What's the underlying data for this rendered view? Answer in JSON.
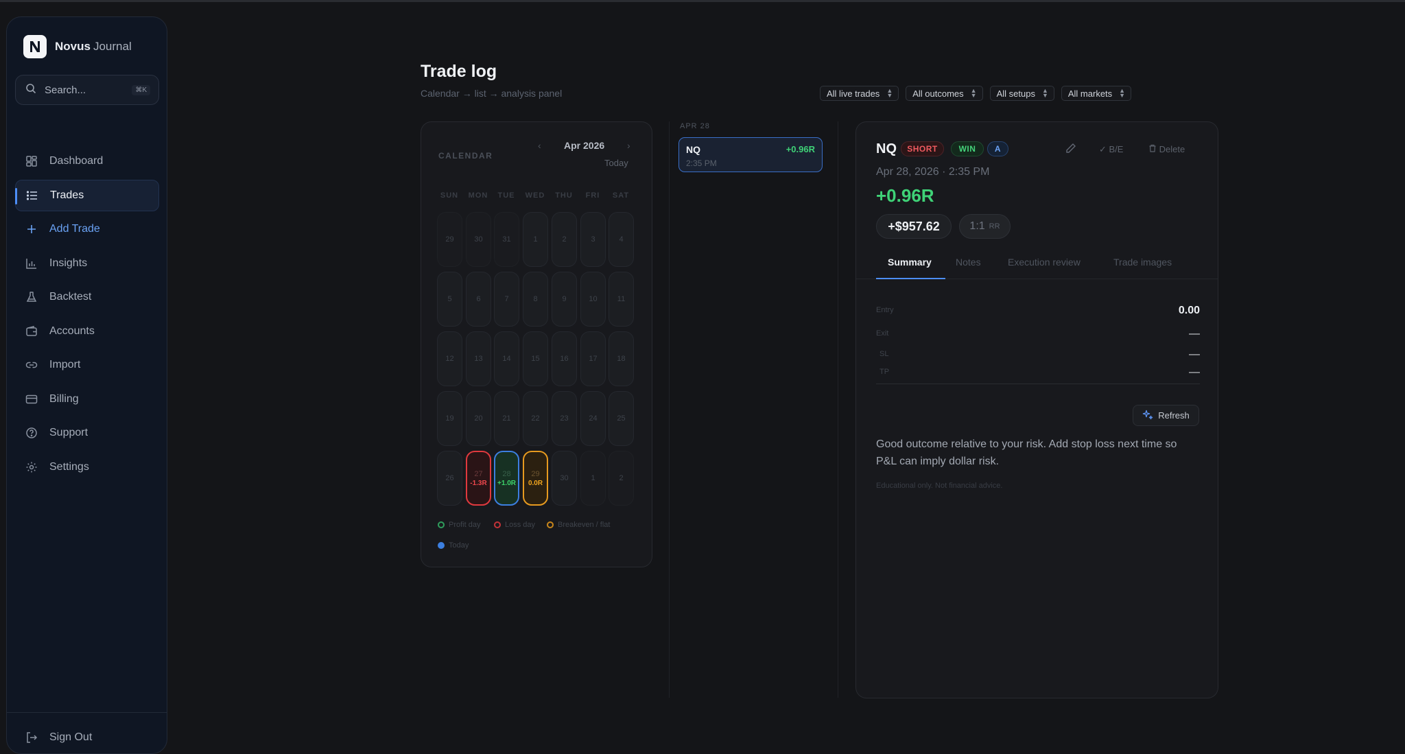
{
  "app": {
    "name_bold": "Novus",
    "name_light": "Journal",
    "logo_letter": "N"
  },
  "search": {
    "placeholder": "Search...",
    "shortcut": "⌘K"
  },
  "nav": [
    {
      "label": "Dashboard",
      "icon": "dashboard-icon"
    },
    {
      "label": "Trades",
      "icon": "list-icon",
      "active": true
    },
    {
      "label": "Add Trade",
      "icon": "plus-icon"
    },
    {
      "label": "Insights",
      "icon": "bar-chart-icon"
    },
    {
      "label": "Backtest",
      "icon": "flask-icon"
    },
    {
      "label": "Accounts",
      "icon": "wallet-icon"
    },
    {
      "label": "Import",
      "icon": "link-icon"
    },
    {
      "label": "Billing",
      "icon": "credit-card-icon"
    },
    {
      "label": "Support",
      "icon": "help-circle-icon"
    },
    {
      "label": "Settings",
      "icon": "gear-icon"
    }
  ],
  "sign_out": "Sign Out",
  "header": {
    "title": "Trade log",
    "subtitle": "Calendar → list → analysis panel"
  },
  "filters": [
    "All live trades",
    "All outcomes",
    "All setups",
    "All markets"
  ],
  "calendar": {
    "label": "CALENDAR",
    "month": "Apr 2026",
    "today_label": "Today",
    "weekdays": [
      "SUN",
      "MON",
      "TUE",
      "WED",
      "THU",
      "FRI",
      "SAT"
    ],
    "weeks": [
      [
        {
          "day": "29",
          "outside": true
        },
        {
          "day": "30",
          "outside": true
        },
        {
          "day": "31",
          "outside": true
        },
        {
          "day": "1"
        },
        {
          "day": "2"
        },
        {
          "day": "3"
        },
        {
          "day": "4"
        }
      ],
      [
        {
          "day": "5"
        },
        {
          "day": "6"
        },
        {
          "day": "7"
        },
        {
          "day": "8"
        },
        {
          "day": "9"
        },
        {
          "day": "10"
        },
        {
          "day": "11"
        }
      ],
      [
        {
          "day": "12"
        },
        {
          "day": "13"
        },
        {
          "day": "14"
        },
        {
          "day": "15"
        },
        {
          "day": "16"
        },
        {
          "day": "17"
        },
        {
          "day": "18"
        }
      ],
      [
        {
          "day": "19"
        },
        {
          "day": "20"
        },
        {
          "day": "21"
        },
        {
          "day": "22"
        },
        {
          "day": "23"
        },
        {
          "day": "24"
        },
        {
          "day": "25"
        }
      ],
      [
        {
          "day": "26"
        },
        {
          "day": "27",
          "status": "loss",
          "value": "-1.3R"
        },
        {
          "day": "28",
          "status": "profit",
          "value": "+1.0R"
        },
        {
          "day": "29",
          "status": "be",
          "value": "0.0R"
        },
        {
          "day": "30"
        },
        {
          "day": "1",
          "outside": true
        },
        {
          "day": "2",
          "outside": true
        }
      ]
    ],
    "legend": [
      {
        "label": "Profit day",
        "color": "#2f9e5c"
      },
      {
        "label": "Loss day",
        "color": "#c33338"
      },
      {
        "label": "Breakeven / flat",
        "color": "#c8861b"
      },
      {
        "label": "Today",
        "color": "#3c7fe0"
      }
    ]
  },
  "list": {
    "date_header": "APR 28",
    "trades": [
      {
        "symbol": "NQ",
        "r": "+0.96R",
        "time": "2:35 PM"
      }
    ]
  },
  "detail": {
    "symbol": "NQ",
    "badges": {
      "direction": "SHORT",
      "outcome": "WIN",
      "grade": "A"
    },
    "actions": {
      "breakeven": "B/E",
      "delete": "Delete"
    },
    "datetime": "Apr 28, 2026 · 2:35 PM",
    "r_multiple": "+0.96R",
    "pnl": "+$957.62",
    "rr": {
      "value": "1:1",
      "label": "RR"
    },
    "tabs": [
      "Summary",
      "Notes",
      "Execution review",
      "Trade images"
    ],
    "fields": [
      {
        "label": "Entry",
        "value": "0.00"
      },
      {
        "label": "Exit",
        "value": "—"
      },
      {
        "label": "SL",
        "value": "—"
      },
      {
        "label": "TP",
        "value": "—"
      }
    ],
    "refresh_label": "Refresh",
    "insight": "Good outcome relative to your risk. Add stop loss next time so P&L can imply dollar risk.",
    "disclaimer": "Educational only. Not financial advice."
  },
  "colors": {
    "accent": "#4d8ef7",
    "profit": "#3fd277",
    "loss": "#f0484d",
    "breakeven": "#f0a51f"
  }
}
